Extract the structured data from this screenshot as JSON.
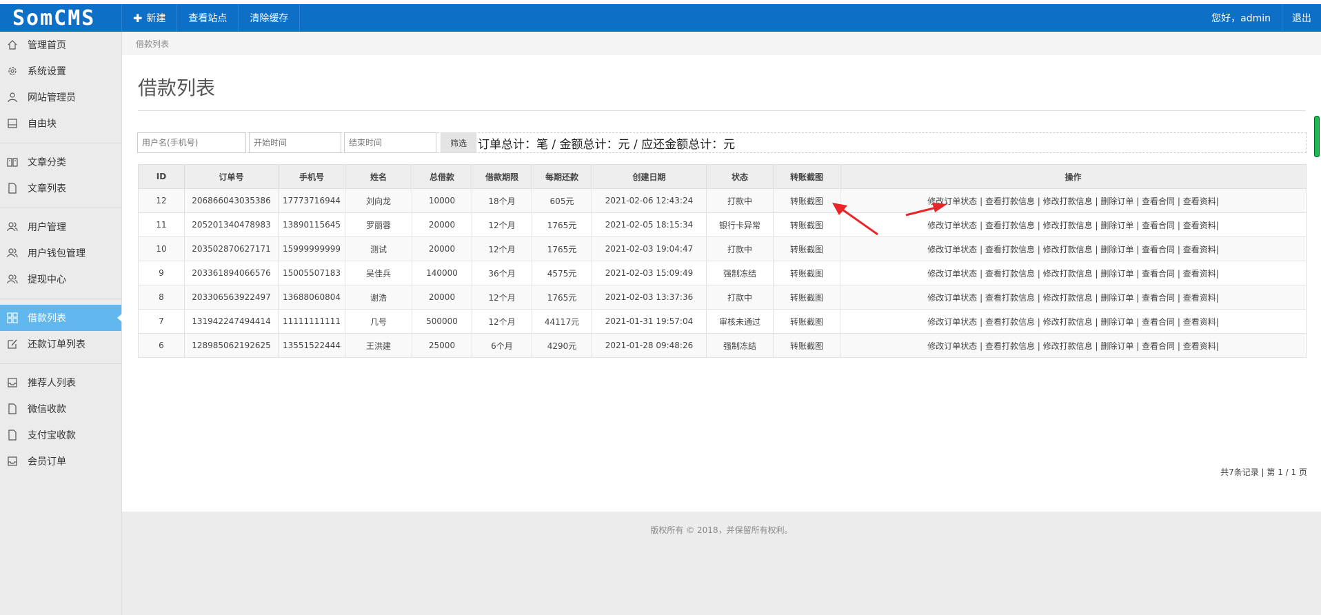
{
  "app": {
    "logo": "SomCMS"
  },
  "topnav": {
    "new_label": "新建",
    "view_site": "查看站点",
    "clear_cache": "清除缓存"
  },
  "user": {
    "greeting": "您好，admin",
    "logout": "退出"
  },
  "sidebar": {
    "items": [
      {
        "label": "管理首页",
        "icon": "home-icon"
      },
      {
        "label": "系统设置",
        "icon": "gear-icon"
      },
      {
        "label": "网站管理员",
        "icon": "user-icon"
      },
      {
        "label": "自由块",
        "icon": "block-icon"
      },
      {
        "label": "文章分类",
        "icon": "book-icon"
      },
      {
        "label": "文章列表",
        "icon": "file-icon"
      },
      {
        "label": "用户管理",
        "icon": "users-icon"
      },
      {
        "label": "用户钱包管理",
        "icon": "users-icon"
      },
      {
        "label": "提现中心",
        "icon": "users-icon"
      },
      {
        "label": "借款列表",
        "icon": "grid-icon",
        "active": true
      },
      {
        "label": "还款订单列表",
        "icon": "edit-icon"
      },
      {
        "label": "推荐人列表",
        "icon": "inbox-icon"
      },
      {
        "label": "微信收款",
        "icon": "file-icon"
      },
      {
        "label": "支付宝收款",
        "icon": "file-icon"
      },
      {
        "label": "会员订单",
        "icon": "inbox-icon"
      }
    ]
  },
  "breadcrumb": "借款列表",
  "page_title": "借款列表",
  "filter": {
    "user_placeholder": "用户名(手机号)",
    "start_placeholder": "开始时间",
    "end_placeholder": "结束时间",
    "button": "筛选",
    "summary": "订单总计：笔 / 金额总计：元 / 应还金额总计：元"
  },
  "table": {
    "headers": [
      "ID",
      "订单号",
      "手机号",
      "姓名",
      "总借款",
      "借款期限",
      "每期还款",
      "创建日期",
      "状态",
      "转账截图",
      "操作"
    ],
    "rows": [
      [
        "12",
        "206866043035386",
        "17773716944",
        "刘向龙",
        "10000",
        "18个月",
        "605元",
        "2021-02-06 12:43:24",
        "打款中",
        "转账截图"
      ],
      [
        "11",
        "205201340478983",
        "13890115645",
        "罗丽蓉",
        "20000",
        "12个月",
        "1765元",
        "2021-02-05 18:15:34",
        "银行卡异常",
        "转账截图"
      ],
      [
        "10",
        "203502870627171",
        "15999999999",
        "测试",
        "20000",
        "12个月",
        "1765元",
        "2021-02-03 19:04:47",
        "打款中",
        "转账截图"
      ],
      [
        "9",
        "203361894066576",
        "15005507183",
        "吴佳兵",
        "140000",
        "36个月",
        "4575元",
        "2021-02-03 15:09:49",
        "强制冻结",
        "转账截图"
      ],
      [
        "8",
        "203306563922497",
        "13688060804",
        "谢浩",
        "20000",
        "12个月",
        "1765元",
        "2021-02-03 13:37:36",
        "打款中",
        "转账截图"
      ],
      [
        "7",
        "131942247494414",
        "11111111111",
        "几号",
        "500000",
        "12个月",
        "44117元",
        "2021-01-31 19:57:04",
        "审核未通过",
        "转账截图"
      ],
      [
        "6",
        "128985062192625",
        "13551522444",
        "王洪建",
        "25000",
        "6个月",
        "4290元",
        "2021-01-28 09:48:26",
        "强制冻结",
        "转账截图"
      ]
    ],
    "operations": [
      "修改订单状态",
      "查看打款信息",
      "修改打款信息",
      "删除订单",
      "查看合同",
      "查看资料"
    ]
  },
  "pager": "共7条记录 | 第 1 / 1 页",
  "footer": "版权所有 © 2018，并保留所有权利。",
  "colors": {
    "topbar": "#0e6fc7",
    "active_item": "#60b8ef",
    "arrow": "#e8262a"
  }
}
